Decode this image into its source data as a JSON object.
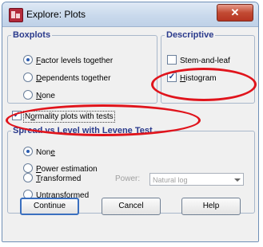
{
  "window": {
    "title": "Explore: Plots",
    "close_glyph": "✕"
  },
  "boxplots": {
    "legend": "Boxplots",
    "options": [
      {
        "label": "Factor levels together",
        "mnemonic": "F",
        "rest": "actor levels together",
        "selected": true
      },
      {
        "label": "Dependents together",
        "mnemonic": "D",
        "rest": "ependents together",
        "selected": false
      },
      {
        "label": "None",
        "mnemonic": "N",
        "rest": "one",
        "selected": false
      }
    ]
  },
  "descriptive": {
    "legend": "Descriptive",
    "stem_and_leaf": {
      "label": "Stem-and-leaf",
      "checked": false
    },
    "histogram": {
      "label": "Histogram",
      "mnemonic": "H",
      "rest": "istogram",
      "checked": true
    }
  },
  "normality": {
    "label": "Normality plots with tests",
    "mnemonic": "o",
    "pre": "N",
    "rest": "rmality plots with tests",
    "checked": true
  },
  "spread": {
    "legend": "Spread vs Level with Levene Test",
    "options": [
      {
        "label": "None",
        "mnemonic": "e",
        "pre": "Non",
        "rest": "",
        "selected": true
      },
      {
        "label": "Power estimation",
        "mnemonic": "P",
        "pre": "",
        "rest": "ower estimation",
        "selected": false
      },
      {
        "label": "Transformed",
        "mnemonic": "T",
        "pre": "",
        "rest": "ransformed",
        "selected": false
      },
      {
        "label": "Untransformed",
        "mnemonic": "U",
        "pre": "",
        "rest": "ntransformed",
        "selected": false
      }
    ],
    "power_label": "Power:",
    "power_value": "Natural log"
  },
  "buttons": {
    "continue": "Continue",
    "cancel": "Cancel",
    "help": "Help"
  },
  "annotation_color": "#e0141c"
}
